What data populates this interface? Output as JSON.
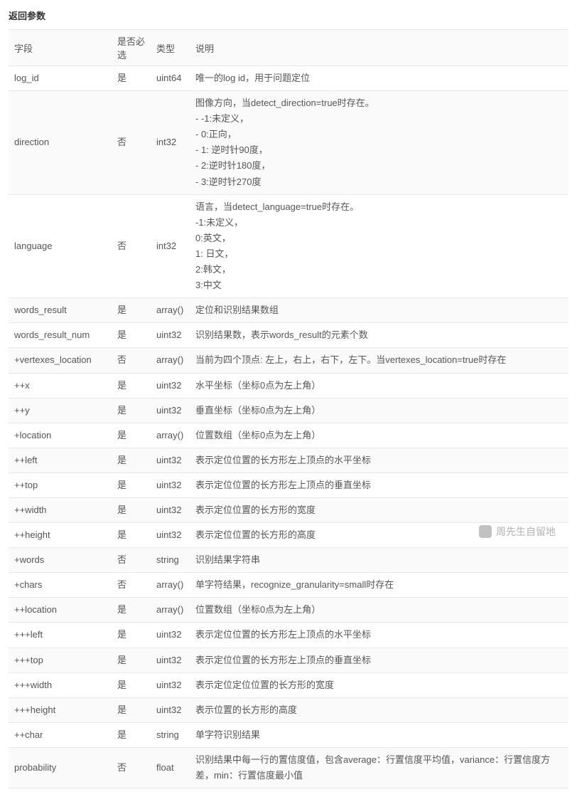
{
  "title": "返回参数",
  "headers": {
    "field": "字段",
    "required": "是否必选",
    "type": "类型",
    "desc": "说明"
  },
  "rows": [
    {
      "field": "log_id",
      "required": "是",
      "type": "uint64",
      "desc": [
        "唯一的log id，用于问题定位"
      ]
    },
    {
      "field": "direction",
      "required": "否",
      "type": "int32",
      "desc": [
        "图像方向，当detect_direction=true时存在。",
        "- -1:未定义，",
        "- 0:正向，",
        "- 1: 逆时针90度，",
        "- 2:逆时针180度，",
        "- 3:逆时针270度"
      ]
    },
    {
      "field": "language",
      "required": "否",
      "type": "int32",
      "desc": [
        "语言，当detect_language=true时存在。",
        "-1:未定义，",
        "0:英文，",
        "1: 日文，",
        "2:韩文，",
        "3:中文"
      ]
    },
    {
      "field": "words_result",
      "required": "是",
      "type": "array()",
      "desc": [
        "定位和识别结果数组"
      ]
    },
    {
      "field": "words_result_num",
      "required": "是",
      "type": "uint32",
      "desc": [
        "识别结果数，表示words_result的元素个数"
      ]
    },
    {
      "field": "+vertexes_location",
      "required": "否",
      "type": "array()",
      "desc": [
        "当前为四个顶点: 左上，右上，右下，左下。当vertexes_location=true时存在"
      ]
    },
    {
      "field": "++x",
      "required": "是",
      "type": "uint32",
      "desc": [
        "水平坐标（坐标0点为左上角）"
      ]
    },
    {
      "field": "++y",
      "required": "是",
      "type": "uint32",
      "desc": [
        "垂直坐标（坐标0点为左上角）"
      ]
    },
    {
      "field": "+location",
      "required": "是",
      "type": "array()",
      "desc": [
        "位置数组（坐标0点为左上角）"
      ]
    },
    {
      "field": "++left",
      "required": "是",
      "type": "uint32",
      "desc": [
        "表示定位位置的长方形左上顶点的水平坐标"
      ]
    },
    {
      "field": "++top",
      "required": "是",
      "type": "uint32",
      "desc": [
        "表示定位位置的长方形左上顶点的垂直坐标"
      ]
    },
    {
      "field": "++width",
      "required": "是",
      "type": "uint32",
      "desc": [
        "表示定位位置的长方形的宽度"
      ]
    },
    {
      "field": "++height",
      "required": "是",
      "type": "uint32",
      "desc": [
        "表示定位位置的长方形的高度"
      ]
    },
    {
      "field": "+words",
      "required": "否",
      "type": "string",
      "desc": [
        "识别结果字符串"
      ]
    },
    {
      "field": "+chars",
      "required": "否",
      "type": "array()",
      "desc": [
        "单字符结果，recognize_granularity=small时存在"
      ]
    },
    {
      "field": "++location",
      "required": "是",
      "type": "array()",
      "desc": [
        "位置数组（坐标0点为左上角）"
      ]
    },
    {
      "field": "+++left",
      "required": "是",
      "type": "uint32",
      "desc": [
        "表示定位位置的长方形左上顶点的水平坐标"
      ]
    },
    {
      "field": "+++top",
      "required": "是",
      "type": "uint32",
      "desc": [
        "表示定位位置的长方形左上顶点的垂直坐标"
      ]
    },
    {
      "field": "+++width",
      "required": "是",
      "type": "uint32",
      "desc": [
        "表示定位定位位置的长方形的宽度"
      ]
    },
    {
      "field": "+++height",
      "required": "是",
      "type": "uint32",
      "desc": [
        "表示位置的长方形的高度"
      ]
    },
    {
      "field": "++char",
      "required": "是",
      "type": "string",
      "desc": [
        "单字符识别结果"
      ]
    },
    {
      "field": "probability",
      "required": "否",
      "type": "float",
      "desc": [
        "识别结果中每一行的置信度值，包含average：行置信度平均值，variance：行置信度方差，min：行置信度最小值"
      ]
    }
  ],
  "watermark": "周先生自留地"
}
